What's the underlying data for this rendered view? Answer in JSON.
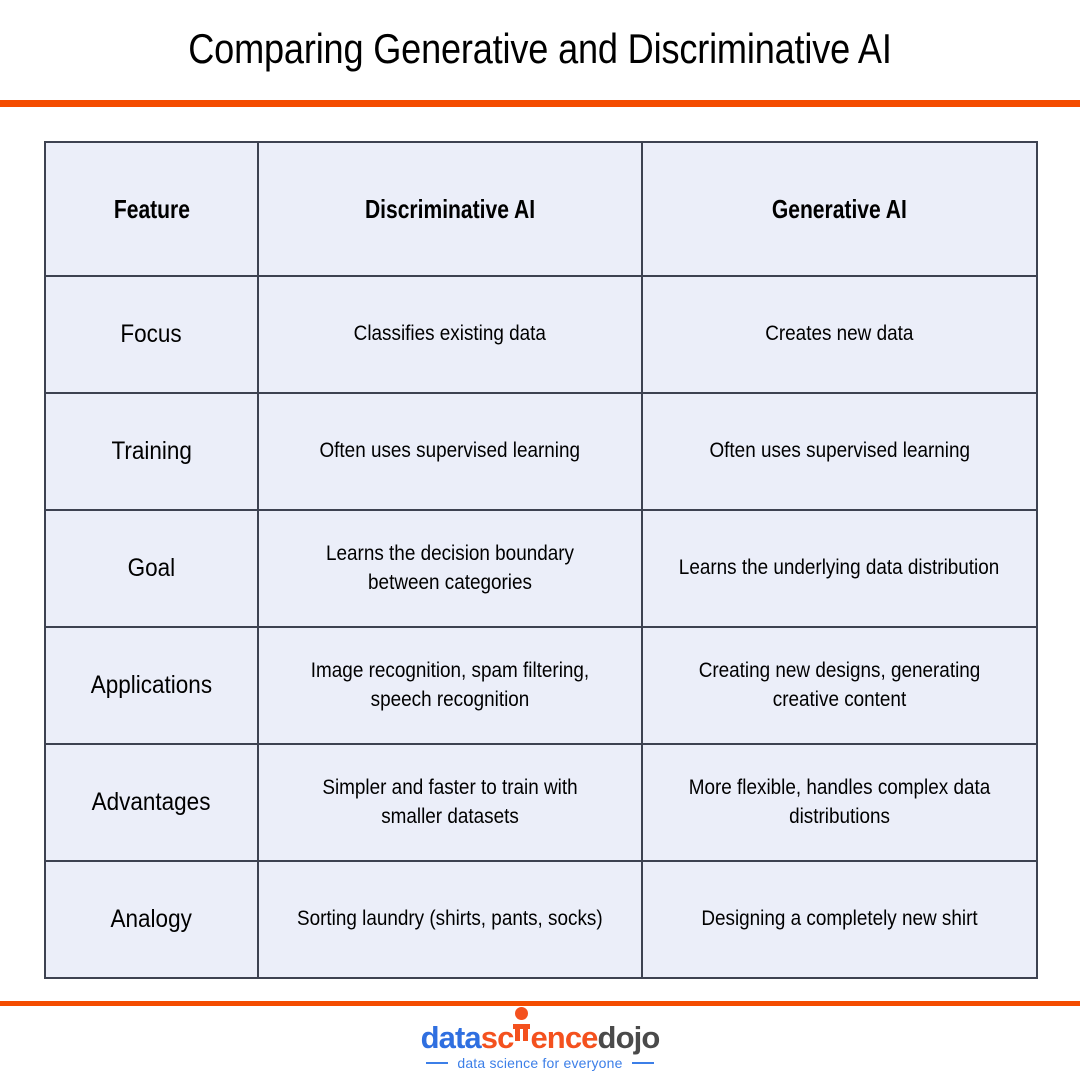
{
  "header": {
    "title": "Comparing Generative and Discriminative AI"
  },
  "colors": {
    "accent_orange": "#f44c00",
    "cell_background": "#ebeef9",
    "cell_border": "#3d4251",
    "logo_blue": "#2f6fe0",
    "logo_orange": "#f4511e",
    "logo_gray": "#4a4a4a",
    "tagline_blue": "#3c7fe8"
  },
  "table": {
    "columns": [
      "Feature",
      "Discriminative AI",
      "Generative AI"
    ],
    "rows": [
      {
        "feature": "Focus",
        "discriminative": "Classifies existing data",
        "generative": "Creates new data"
      },
      {
        "feature": "Training",
        "discriminative": "Often uses supervised learning",
        "generative": "Often uses supervised learning"
      },
      {
        "feature": "Goal",
        "discriminative": "Learns the decision boundary between categories",
        "generative": "Learns the underlying data distribution"
      },
      {
        "feature": "Applications",
        "discriminative": "Image recognition, spam filtering, speech recognition",
        "generative": "Creating new designs, generating creative content"
      },
      {
        "feature": "Advantages",
        "discriminative": "Simpler and faster to train with smaller datasets",
        "generative": "More flexible, handles complex data distributions"
      },
      {
        "feature": "Analogy",
        "discriminative": "Sorting laundry (shirts, pants, socks)",
        "generative": "Designing a completely new shirt"
      }
    ]
  },
  "footer": {
    "logo": {
      "part_data": "data",
      "part_sc": "sc",
      "part_ence": "ence",
      "part_dojo": "dojo",
      "icon": "person-figure-icon"
    },
    "tagline": "data science for everyone"
  }
}
